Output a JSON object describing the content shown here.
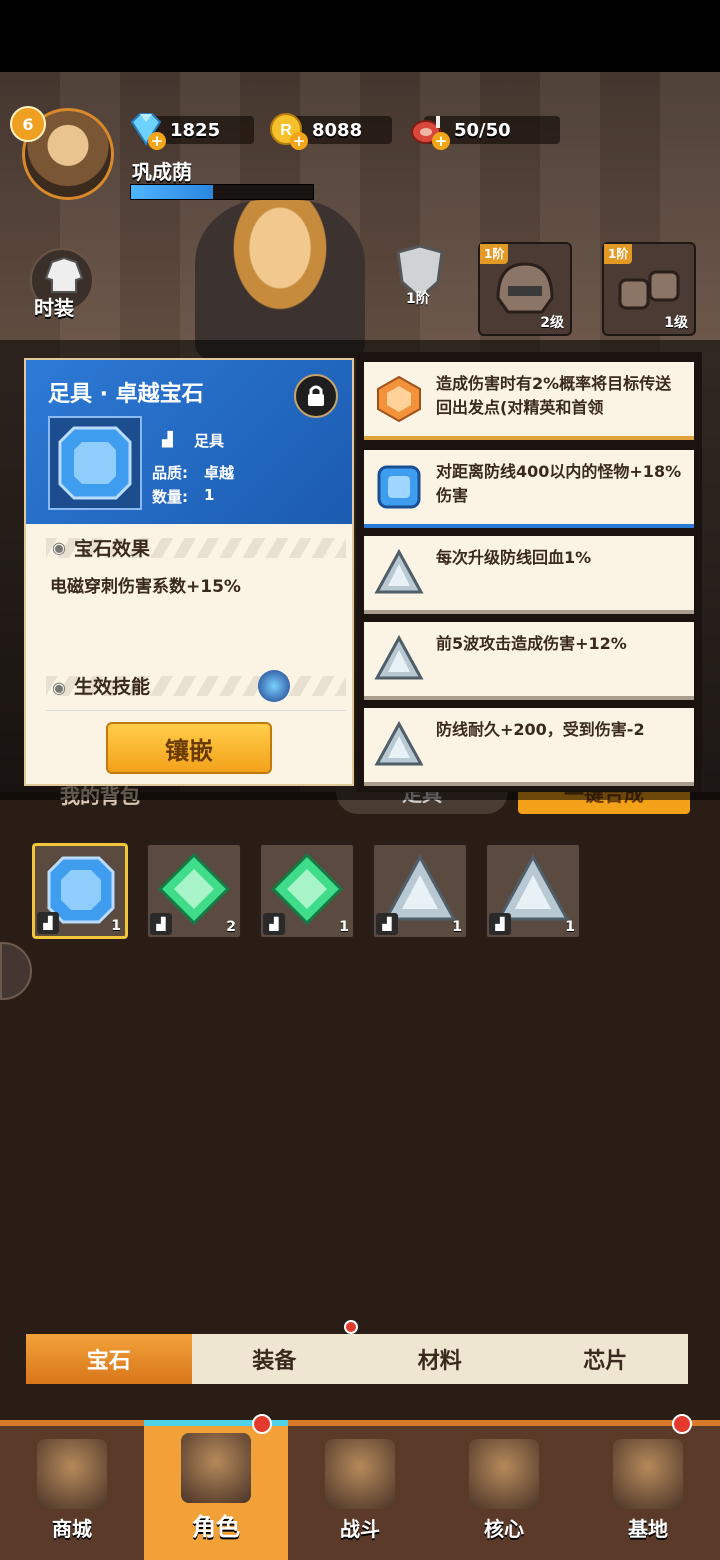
{
  "player": {
    "level": "6",
    "name": "巩成荫",
    "xp_fraction": 0.45
  },
  "resources": [
    {
      "name": "diamond",
      "value": "1825",
      "icon": "diamond-icon",
      "color": "#5fc8ff"
    },
    {
      "name": "coin",
      "value": "8088",
      "icon": "coin-icon",
      "color": "#f2b81c"
    },
    {
      "name": "stamina",
      "value": "50/50",
      "icon": "meat-icon",
      "color": "#e0563b"
    }
  ],
  "side": {
    "fashion_label": "时装"
  },
  "equipment": [
    {
      "tier": "",
      "label": "1阶",
      "level": "",
      "icon": "shield-icon"
    },
    {
      "tier": "1阶",
      "level": "2级",
      "icon": "helmet-icon"
    },
    {
      "tier": "1阶",
      "level": "1级",
      "icon": "gauntlet-icon"
    }
  ],
  "gem_card": {
    "title": "足具 · 卓越宝石",
    "slot": "足具",
    "quality_label": "品质:",
    "quality": "卓越",
    "count_label": "数量:",
    "count": "1",
    "effect_header": "宝石效果",
    "effect": "电磁穿刺伤害系数+15%",
    "skill_header": "生效技能",
    "inset_button": "镶嵌",
    "accent": "#2d7ad6"
  },
  "effects": [
    {
      "icon": "orange-gem-icon",
      "text": "造成伤害时有2%概率将目标传送回出发点(对精英和首领"
    },
    {
      "icon": "blue-gem-icon",
      "text": "对距离防线400以内的怪物+18%伤害"
    },
    {
      "icon": "triangle-gem-icon",
      "text": "每次升级防线回血1%"
    },
    {
      "icon": "triangle-gem-icon",
      "text": "前5波攻击造成伤害+12%"
    },
    {
      "icon": "triangle-gem-icon",
      "text": "防线耐久+200，受到伤害-2"
    }
  ],
  "under_row": {
    "bag_label": "我的背包",
    "filter_label": "足具",
    "merge_button": "一键合成"
  },
  "bag": [
    {
      "icon": "blue-gem-icon",
      "count": "1",
      "selected": true
    },
    {
      "icon": "green-gem-icon",
      "count": "2"
    },
    {
      "icon": "green-gem-icon",
      "count": "1"
    },
    {
      "icon": "triangle-gem-icon",
      "count": "1"
    },
    {
      "icon": "triangle-gem-icon",
      "count": "1"
    }
  ],
  "category_tabs": [
    "宝石",
    "装备",
    "材料",
    "芯片"
  ],
  "nav": [
    {
      "label": "商城",
      "icon": "shop-icon"
    },
    {
      "label": "角色",
      "icon": "character-icon"
    },
    {
      "label": "战斗",
      "icon": "battle-icon"
    },
    {
      "label": "核心",
      "icon": "core-icon"
    },
    {
      "label": "基地",
      "icon": "base-icon"
    }
  ]
}
